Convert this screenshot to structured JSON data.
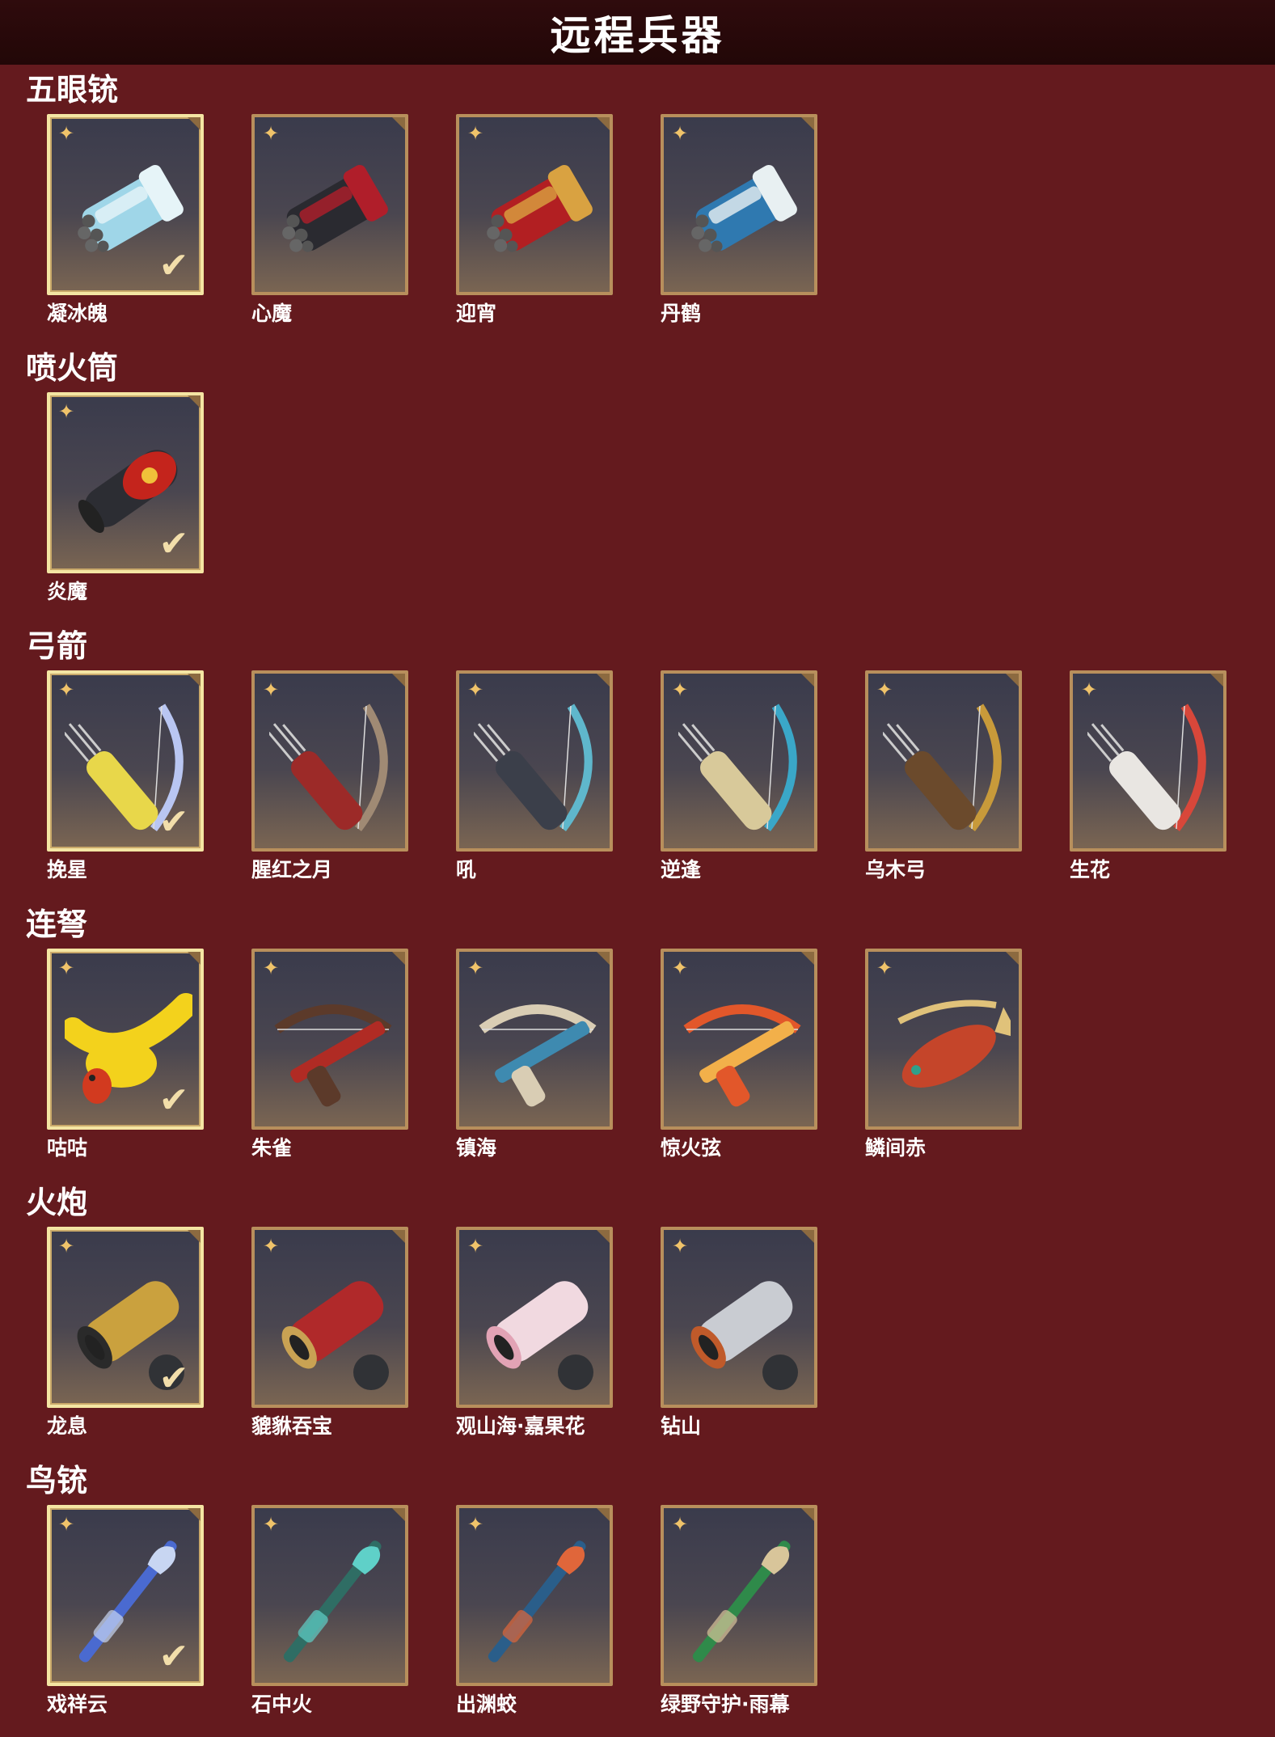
{
  "header": {
    "title": "远程兵器"
  },
  "categories": [
    {
      "title": "五眼铳",
      "items": [
        {
          "name": "凝冰魄",
          "equipped": true,
          "art": "fivebarrel-gun",
          "c1": "#9fd6e8",
          "c2": "#e6f4f8"
        },
        {
          "name": "心魔",
          "equipped": false,
          "art": "fivebarrel-gun",
          "c1": "#2a2a30",
          "c2": "#b01e2a"
        },
        {
          "name": "迎宵",
          "equipped": false,
          "art": "fivebarrel-gun",
          "c1": "#b21f22",
          "c2": "#d9a241"
        },
        {
          "name": "丹鹤",
          "equipped": false,
          "art": "fivebarrel-gun",
          "c1": "#2f79b0",
          "c2": "#e8f0f2"
        }
      ]
    },
    {
      "title": "喷火筒",
      "items": [
        {
          "name": "炎魔",
          "equipped": true,
          "art": "flame-tube",
          "c1": "#2c2d33",
          "c2": "#c4241c"
        }
      ]
    },
    {
      "title": "弓箭",
      "items": [
        {
          "name": "挽星",
          "equipped": true,
          "art": "bow",
          "c1": "#e8d74a",
          "c2": "#b9c6f2"
        },
        {
          "name": "腥红之月",
          "equipped": false,
          "art": "bow",
          "c1": "#9c2a28",
          "c2": "#a08a74"
        },
        {
          "name": "吼",
          "equipped": false,
          "art": "bow",
          "c1": "#3b3f4a",
          "c2": "#5fb7cc"
        },
        {
          "name": "逆逢",
          "equipped": false,
          "art": "bow",
          "c1": "#d8c99a",
          "c2": "#3aa7c8"
        },
        {
          "name": "乌木弓",
          "equipped": false,
          "art": "bow",
          "c1": "#6b4a2c",
          "c2": "#c89a3a"
        },
        {
          "name": "生花",
          "equipped": false,
          "art": "bow",
          "c1": "#e9e6e2",
          "c2": "#d8473a"
        }
      ]
    },
    {
      "title": "连弩",
      "items": [
        {
          "name": "咕咕",
          "equipped": true,
          "art": "rubber-chicken",
          "c1": "#f3d21c",
          "c2": "#d23a1f"
        },
        {
          "name": "朱雀",
          "equipped": false,
          "art": "crossbow",
          "c1": "#5c3a2a",
          "c2": "#b02b24"
        },
        {
          "name": "镇海",
          "equipped": false,
          "art": "crossbow",
          "c1": "#d9cdb4",
          "c2": "#3e8ab0"
        },
        {
          "name": "惊火弦",
          "equipped": false,
          "art": "crossbow",
          "c1": "#e2572a",
          "c2": "#f2b04a"
        },
        {
          "name": "鳞间赤",
          "equipped": false,
          "art": "fish-crossbow",
          "c1": "#c5452a",
          "c2": "#e0c27a"
        }
      ]
    },
    {
      "title": "火炮",
      "items": [
        {
          "name": "龙息",
          "equipped": true,
          "art": "cannon",
          "c1": "#caa13e",
          "c2": "#2a2a2a"
        },
        {
          "name": "貔貅吞宝",
          "equipped": false,
          "art": "cannon",
          "c1": "#b0292a",
          "c2": "#c9a253"
        },
        {
          "name": "观山海·嘉果花",
          "equipped": false,
          "art": "cannon",
          "c1": "#f1d9e0",
          "c2": "#e2a3b5"
        },
        {
          "name": "钻山",
          "equipped": false,
          "art": "cannon",
          "c1": "#c9ccd2",
          "c2": "#c05a2a"
        }
      ]
    },
    {
      "title": "鸟铳",
      "items": [
        {
          "name": "戏祥云",
          "equipped": true,
          "art": "musket",
          "c1": "#4a6ad0",
          "c2": "#c8d6f2"
        },
        {
          "name": "石中火",
          "equipped": false,
          "art": "musket",
          "c1": "#2f6d64",
          "c2": "#5fd0c8"
        },
        {
          "name": "出渊蛟",
          "equipped": false,
          "art": "musket",
          "c1": "#2a5e8a",
          "c2": "#e0663a"
        },
        {
          "name": "绿野守护·雨幕",
          "equipped": false,
          "art": "musket",
          "c1": "#2f8a4a",
          "c2": "#d8c59a"
        }
      ]
    }
  ],
  "icons": {
    "rank": "shuriken-icon",
    "equipped": "checkmark-icon",
    "corner": "corner-tag-icon"
  },
  "colors": {
    "background": "#641a1e",
    "header": "#2a0a0b",
    "frame": "#b88f5c",
    "frame_equipped": "#f4e5a3"
  }
}
